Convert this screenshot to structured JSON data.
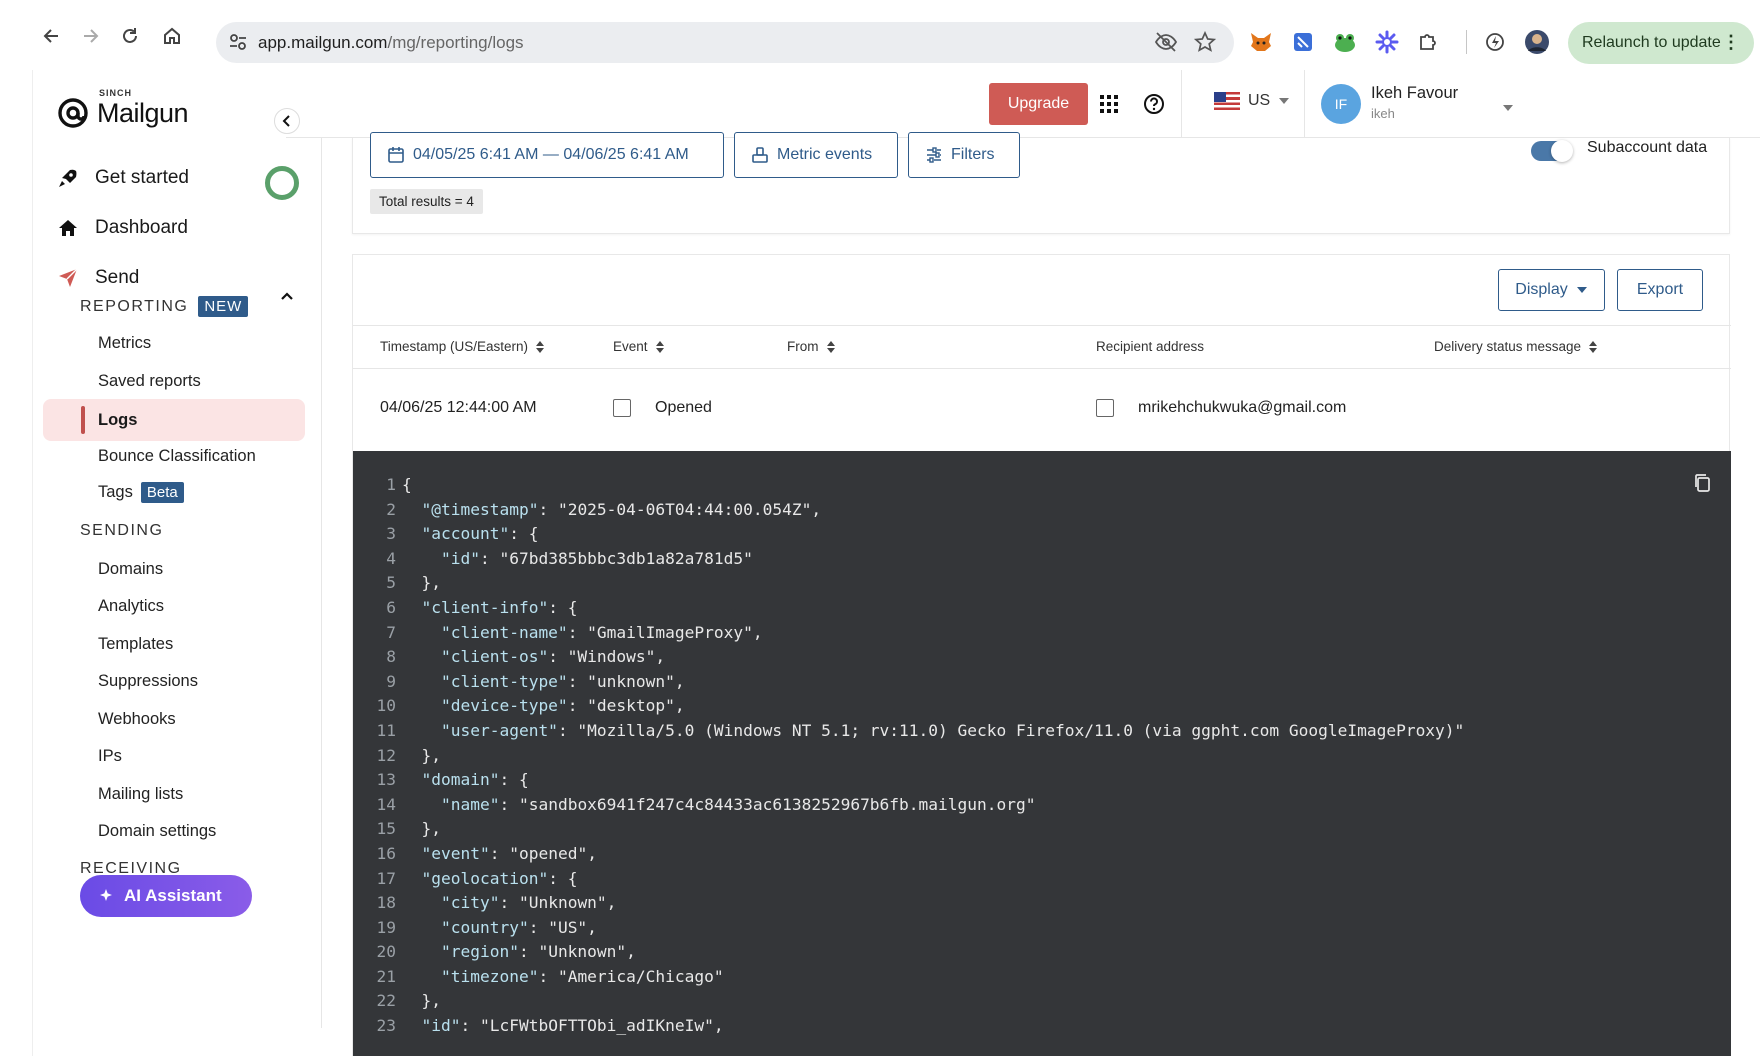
{
  "browser": {
    "url_host": "app.mailgun.com",
    "url_path": "/mg/reporting/logs",
    "relaunch_label": "Relaunch to update"
  },
  "brand": {
    "sinch": "SINCH",
    "name": "Mailgun",
    "accent": "#cf5b55"
  },
  "sidebar": {
    "get_started": "Get started",
    "dashboard": "Dashboard",
    "send": "Send",
    "reporting": "REPORTING",
    "new_badge": "NEW",
    "metrics": "Metrics",
    "saved_reports": "Saved reports",
    "logs": "Logs",
    "bounce": "Bounce Classification",
    "tags": "Tags",
    "beta_badge": "Beta",
    "sending": "SENDING",
    "domains": "Domains",
    "analytics": "Analytics",
    "templates": "Templates",
    "suppressions": "Suppressions",
    "webhooks": "Webhooks",
    "ips": "IPs",
    "mailing_lists": "Mailing lists",
    "domain_settings": "Domain settings",
    "receiving": "RECEIVING",
    "ai_assistant": "AI Assistant"
  },
  "header": {
    "upgrade": "Upgrade",
    "region": "US",
    "avatar_initials": "IF",
    "user_name": "Ikeh Favour",
    "user_sub": "ikeh"
  },
  "filters": {
    "date_range": "04/05/25 6:41 AM — 04/06/25 6:41 AM",
    "metric_events": "Metric events",
    "filters": "Filters",
    "total_results": "Total results = 4",
    "subaccount_label": "Subaccount data"
  },
  "toolbar": {
    "display": "Display",
    "export": "Export"
  },
  "table": {
    "columns": {
      "timestamp": "Timestamp (US/Eastern)",
      "event": "Event",
      "from": "From",
      "recipient": "Recipient address",
      "delivery": "Delivery status message"
    },
    "row": {
      "timestamp": "04/06/25 12:44:00 AM",
      "event": "Opened",
      "recipient": "mrikehchukwuka@gmail.com"
    }
  },
  "code_lines": [
    "{",
    "  \"@timestamp\": \"2025-04-06T04:44:00.054Z\",",
    "  \"account\": {",
    "    \"id\": \"67bd385bbbc3db1a82a781d5\"",
    "  },",
    "  \"client-info\": {",
    "    \"client-name\": \"GmailImageProxy\",",
    "    \"client-os\": \"Windows\",",
    "    \"client-type\": \"unknown\",",
    "    \"device-type\": \"desktop\",",
    "    \"user-agent\": \"Mozilla/5.0 (Windows NT 5.1; rv:11.0) Gecko Firefox/11.0 (via ggpht.com GoogleImageProxy)\"",
    "  },",
    "  \"domain\": {",
    "    \"name\": \"sandbox6941f247c4c84433ac6138252967b6fb.mailgun.org\"",
    "  },",
    "  \"event\": \"opened\",",
    "  \"geolocation\": {",
    "    \"city\": \"Unknown\",",
    "    \"country\": \"US\",",
    "    \"region\": \"Unknown\",",
    "    \"timezone\": \"America/Chicago\"",
    "  },",
    "  \"id\": \"LcFWtbOFTTObi_adIKneIw\","
  ]
}
